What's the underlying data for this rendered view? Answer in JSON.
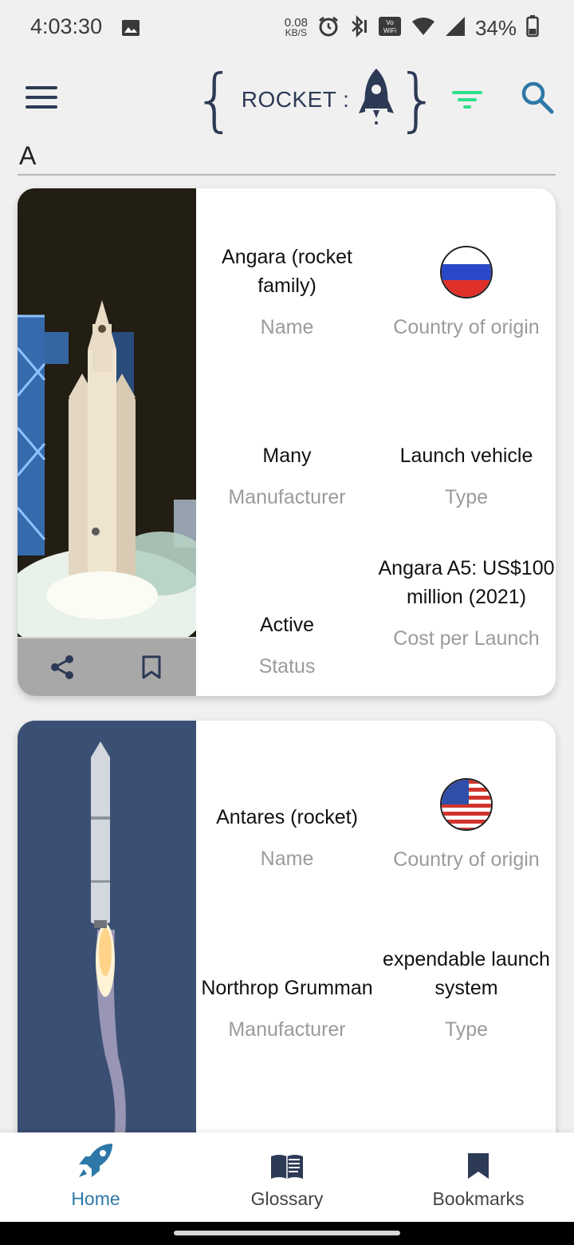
{
  "status_bar": {
    "time": "4:03:30",
    "speed_value": "0.08",
    "speed_unit": "KB/S",
    "battery": "34%",
    "icons": [
      "gallery-icon",
      "alarm-icon",
      "bluetooth-icon",
      "vowifi-icon",
      "wifi-icon",
      "signal-icon",
      "battery-icon"
    ]
  },
  "app_bar": {
    "logo_text": "ROCKET :",
    "menu_icon": "hamburger-menu-icon",
    "filter_icon": "filter-icon",
    "search_icon": "search-icon",
    "filter_color": "#2ee08a",
    "search_color": "#2e78a8"
  },
  "search": {
    "value": "A"
  },
  "rockets": [
    {
      "name": "Angara (rocket family)",
      "name_label": "Name",
      "country_label": "Country of origin",
      "country_flag": "russia-flag",
      "manufacturer": "Many",
      "manufacturer_label": "Manufacturer",
      "type": "Launch vehicle",
      "type_label": "Type",
      "status": "Active",
      "status_label": "Status",
      "cost": "Angara A5: US$100 million (2021)",
      "cost_label": "Cost per Launch"
    },
    {
      "name": "Antares (rocket)",
      "name_label": "Name",
      "country_label": "Country of origin",
      "country_flag": "usa-flag",
      "manufacturer": "Northrop Grumman",
      "manufacturer_label": "Manufacturer",
      "type": "expendable launch system",
      "type_label": "Type"
    }
  ],
  "bottom_nav": {
    "items": [
      {
        "label": "Home",
        "icon": "rocket-icon",
        "active": true
      },
      {
        "label": "Glossary",
        "icon": "book-icon",
        "active": false
      },
      {
        "label": "Bookmarks",
        "icon": "bookmark-icon",
        "active": false
      }
    ],
    "active_color": "#2e78a8"
  }
}
